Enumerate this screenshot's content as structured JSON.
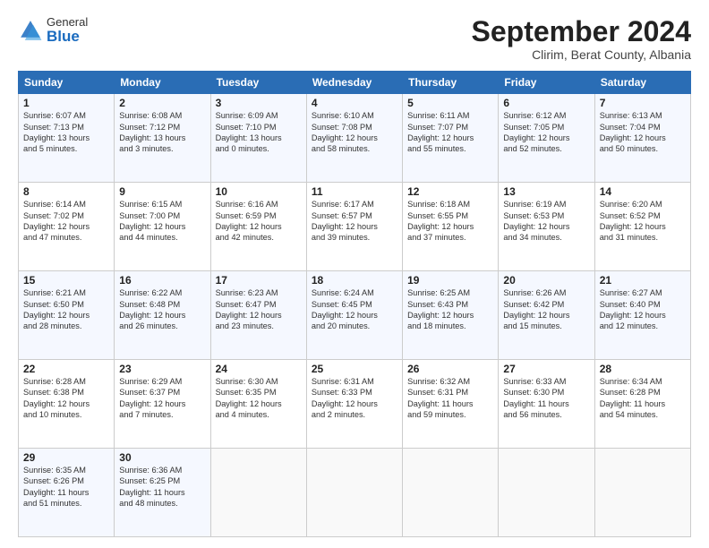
{
  "logo": {
    "general": "General",
    "blue": "Blue"
  },
  "header": {
    "month": "September 2024",
    "location": "Clirim, Berat County, Albania"
  },
  "weekdays": [
    "Sunday",
    "Monday",
    "Tuesday",
    "Wednesday",
    "Thursday",
    "Friday",
    "Saturday"
  ],
  "weeks": [
    [
      {
        "day": "1",
        "info": "Sunrise: 6:07 AM\nSunset: 7:13 PM\nDaylight: 13 hours\nand 5 minutes."
      },
      {
        "day": "2",
        "info": "Sunrise: 6:08 AM\nSunset: 7:12 PM\nDaylight: 13 hours\nand 3 minutes."
      },
      {
        "day": "3",
        "info": "Sunrise: 6:09 AM\nSunset: 7:10 PM\nDaylight: 13 hours\nand 0 minutes."
      },
      {
        "day": "4",
        "info": "Sunrise: 6:10 AM\nSunset: 7:08 PM\nDaylight: 12 hours\nand 58 minutes."
      },
      {
        "day": "5",
        "info": "Sunrise: 6:11 AM\nSunset: 7:07 PM\nDaylight: 12 hours\nand 55 minutes."
      },
      {
        "day": "6",
        "info": "Sunrise: 6:12 AM\nSunset: 7:05 PM\nDaylight: 12 hours\nand 52 minutes."
      },
      {
        "day": "7",
        "info": "Sunrise: 6:13 AM\nSunset: 7:04 PM\nDaylight: 12 hours\nand 50 minutes."
      }
    ],
    [
      {
        "day": "8",
        "info": "Sunrise: 6:14 AM\nSunset: 7:02 PM\nDaylight: 12 hours\nand 47 minutes."
      },
      {
        "day": "9",
        "info": "Sunrise: 6:15 AM\nSunset: 7:00 PM\nDaylight: 12 hours\nand 44 minutes."
      },
      {
        "day": "10",
        "info": "Sunrise: 6:16 AM\nSunset: 6:59 PM\nDaylight: 12 hours\nand 42 minutes."
      },
      {
        "day": "11",
        "info": "Sunrise: 6:17 AM\nSunset: 6:57 PM\nDaylight: 12 hours\nand 39 minutes."
      },
      {
        "day": "12",
        "info": "Sunrise: 6:18 AM\nSunset: 6:55 PM\nDaylight: 12 hours\nand 37 minutes."
      },
      {
        "day": "13",
        "info": "Sunrise: 6:19 AM\nSunset: 6:53 PM\nDaylight: 12 hours\nand 34 minutes."
      },
      {
        "day": "14",
        "info": "Sunrise: 6:20 AM\nSunset: 6:52 PM\nDaylight: 12 hours\nand 31 minutes."
      }
    ],
    [
      {
        "day": "15",
        "info": "Sunrise: 6:21 AM\nSunset: 6:50 PM\nDaylight: 12 hours\nand 28 minutes."
      },
      {
        "day": "16",
        "info": "Sunrise: 6:22 AM\nSunset: 6:48 PM\nDaylight: 12 hours\nand 26 minutes."
      },
      {
        "day": "17",
        "info": "Sunrise: 6:23 AM\nSunset: 6:47 PM\nDaylight: 12 hours\nand 23 minutes."
      },
      {
        "day": "18",
        "info": "Sunrise: 6:24 AM\nSunset: 6:45 PM\nDaylight: 12 hours\nand 20 minutes."
      },
      {
        "day": "19",
        "info": "Sunrise: 6:25 AM\nSunset: 6:43 PM\nDaylight: 12 hours\nand 18 minutes."
      },
      {
        "day": "20",
        "info": "Sunrise: 6:26 AM\nSunset: 6:42 PM\nDaylight: 12 hours\nand 15 minutes."
      },
      {
        "day": "21",
        "info": "Sunrise: 6:27 AM\nSunset: 6:40 PM\nDaylight: 12 hours\nand 12 minutes."
      }
    ],
    [
      {
        "day": "22",
        "info": "Sunrise: 6:28 AM\nSunset: 6:38 PM\nDaylight: 12 hours\nand 10 minutes."
      },
      {
        "day": "23",
        "info": "Sunrise: 6:29 AM\nSunset: 6:37 PM\nDaylight: 12 hours\nand 7 minutes."
      },
      {
        "day": "24",
        "info": "Sunrise: 6:30 AM\nSunset: 6:35 PM\nDaylight: 12 hours\nand 4 minutes."
      },
      {
        "day": "25",
        "info": "Sunrise: 6:31 AM\nSunset: 6:33 PM\nDaylight: 12 hours\nand 2 minutes."
      },
      {
        "day": "26",
        "info": "Sunrise: 6:32 AM\nSunset: 6:31 PM\nDaylight: 11 hours\nand 59 minutes."
      },
      {
        "day": "27",
        "info": "Sunrise: 6:33 AM\nSunset: 6:30 PM\nDaylight: 11 hours\nand 56 minutes."
      },
      {
        "day": "28",
        "info": "Sunrise: 6:34 AM\nSunset: 6:28 PM\nDaylight: 11 hours\nand 54 minutes."
      }
    ],
    [
      {
        "day": "29",
        "info": "Sunrise: 6:35 AM\nSunset: 6:26 PM\nDaylight: 11 hours\nand 51 minutes."
      },
      {
        "day": "30",
        "info": "Sunrise: 6:36 AM\nSunset: 6:25 PM\nDaylight: 11 hours\nand 48 minutes."
      },
      null,
      null,
      null,
      null,
      null
    ]
  ]
}
